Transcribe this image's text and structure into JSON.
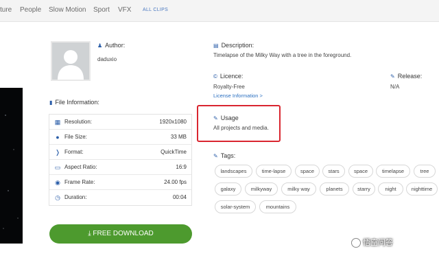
{
  "nav": {
    "items": [
      "ture",
      "People",
      "Slow Motion",
      "Sport",
      "VFX"
    ],
    "all_clips": "ALL CLIPS"
  },
  "author": {
    "label": "Author:",
    "name": "daduxio"
  },
  "file_info": {
    "label": "File Information:",
    "rows": [
      {
        "icon": "film-icon",
        "label": "Resolution:",
        "value": "1920x1080"
      },
      {
        "icon": "file-icon",
        "label": "File Size:",
        "value": "33 MB"
      },
      {
        "icon": "code-icon",
        "label": "Format:",
        "value": "QuickTime"
      },
      {
        "icon": "monitor-icon",
        "label": "Aspect Ratio:",
        "value": "16:9"
      },
      {
        "icon": "camera-icon",
        "label": "Frame Rate:",
        "value": "24.00 fps"
      },
      {
        "icon": "clock-icon",
        "label": "Duration:",
        "value": "00:04"
      }
    ]
  },
  "download": {
    "label": "FREE DOWNLOAD"
  },
  "description": {
    "label": "Description:",
    "text": "Timelapse of the Milky Way with a tree in the foreground."
  },
  "licence": {
    "label": "Licence:",
    "value": "Royalty-Free",
    "link": "License Information >"
  },
  "release": {
    "label": "Release:",
    "value": "N/A"
  },
  "usage": {
    "label": "Usage",
    "text": "All projects and media."
  },
  "tags": {
    "label": "Tags:",
    "items": [
      "landscapes",
      "time-lapse",
      "space",
      "stars",
      "space",
      "timelapse",
      "tree",
      "galaxy",
      "milkyway",
      "milky way",
      "planets",
      "starry",
      "night",
      "nighttime",
      "solar-system",
      "mountains"
    ]
  },
  "watermark": {
    "text": "悟空问答"
  },
  "colors": {
    "accent": "#2a5da8",
    "download": "#4d9a2e",
    "highlight": "#d9252f"
  }
}
